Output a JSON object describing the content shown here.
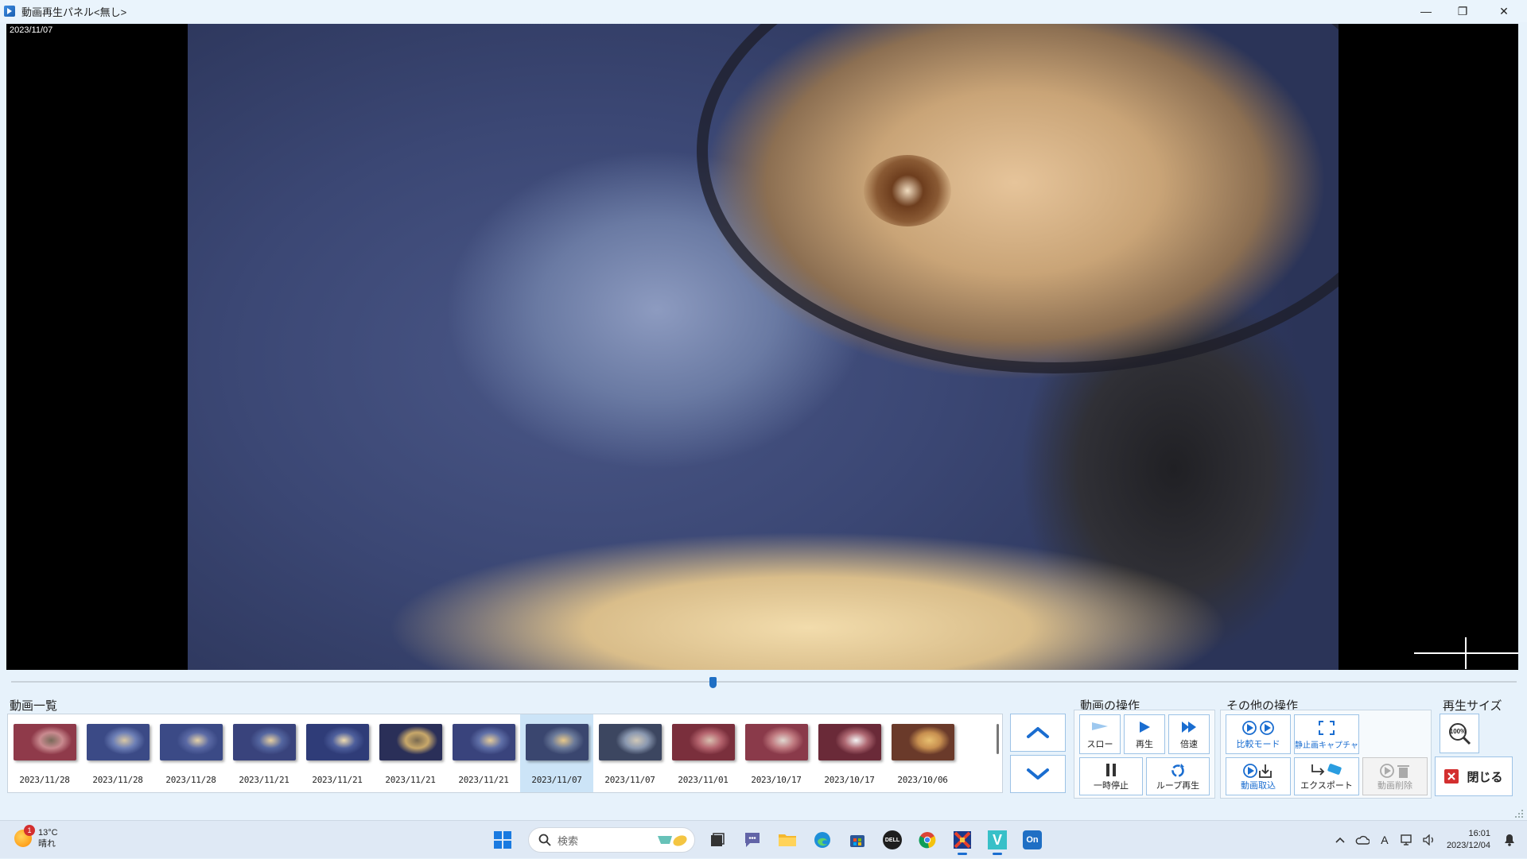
{
  "window": {
    "title": "動画再生パネル<無し>",
    "minimize_glyph": "—",
    "maximize_glyph": "❐",
    "close_glyph": "✕"
  },
  "video": {
    "date_overlay": "2023/11/07",
    "playback_position": 0.466
  },
  "groups": {
    "video_list": "動画一覧",
    "video_ops": "動画の操作",
    "other_ops": "その他の操作",
    "play_size": "再生サイズ"
  },
  "thumbnails": [
    {
      "date": "2023/11/28",
      "selected": false
    },
    {
      "date": "2023/11/28",
      "selected": false
    },
    {
      "date": "2023/11/28",
      "selected": false
    },
    {
      "date": "2023/11/21",
      "selected": false
    },
    {
      "date": "2023/11/21",
      "selected": false
    },
    {
      "date": "2023/11/21",
      "selected": false
    },
    {
      "date": "2023/11/21",
      "selected": false
    },
    {
      "date": "2023/11/07",
      "selected": true
    },
    {
      "date": "2023/11/07",
      "selected": false
    },
    {
      "date": "2023/11/01",
      "selected": false
    },
    {
      "date": "2023/10/17",
      "selected": false
    },
    {
      "date": "2023/10/17",
      "selected": false
    },
    {
      "date": "2023/10/06",
      "selected": false
    }
  ],
  "video_ops": {
    "slow": "スロー",
    "play": "再生",
    "fast": "倍速",
    "pause": "一時停止",
    "loop": "ループ再生"
  },
  "other_ops": {
    "compare": "比較モード",
    "still_capture": "静止画キャプチャ",
    "import": "動画取込",
    "export": "エクスポート",
    "delete": "動画削除"
  },
  "play_size": {
    "zoom_icon_text": "100%",
    "close": "閉じる"
  },
  "colors": {
    "accent": "#1a6dd0",
    "button_border": "#9dc3e6",
    "close_red": "#d32f2f",
    "panel_bg": "#e7f2fb"
  },
  "taskbar": {
    "weather_temp": "13°C",
    "weather_desc": "晴れ",
    "weather_badge": "1",
    "search_placeholder": "検索",
    "time": "16:01",
    "date": "2023/12/04",
    "ime": "A",
    "dell": "DELL",
    "v": "V",
    "on": "On"
  }
}
